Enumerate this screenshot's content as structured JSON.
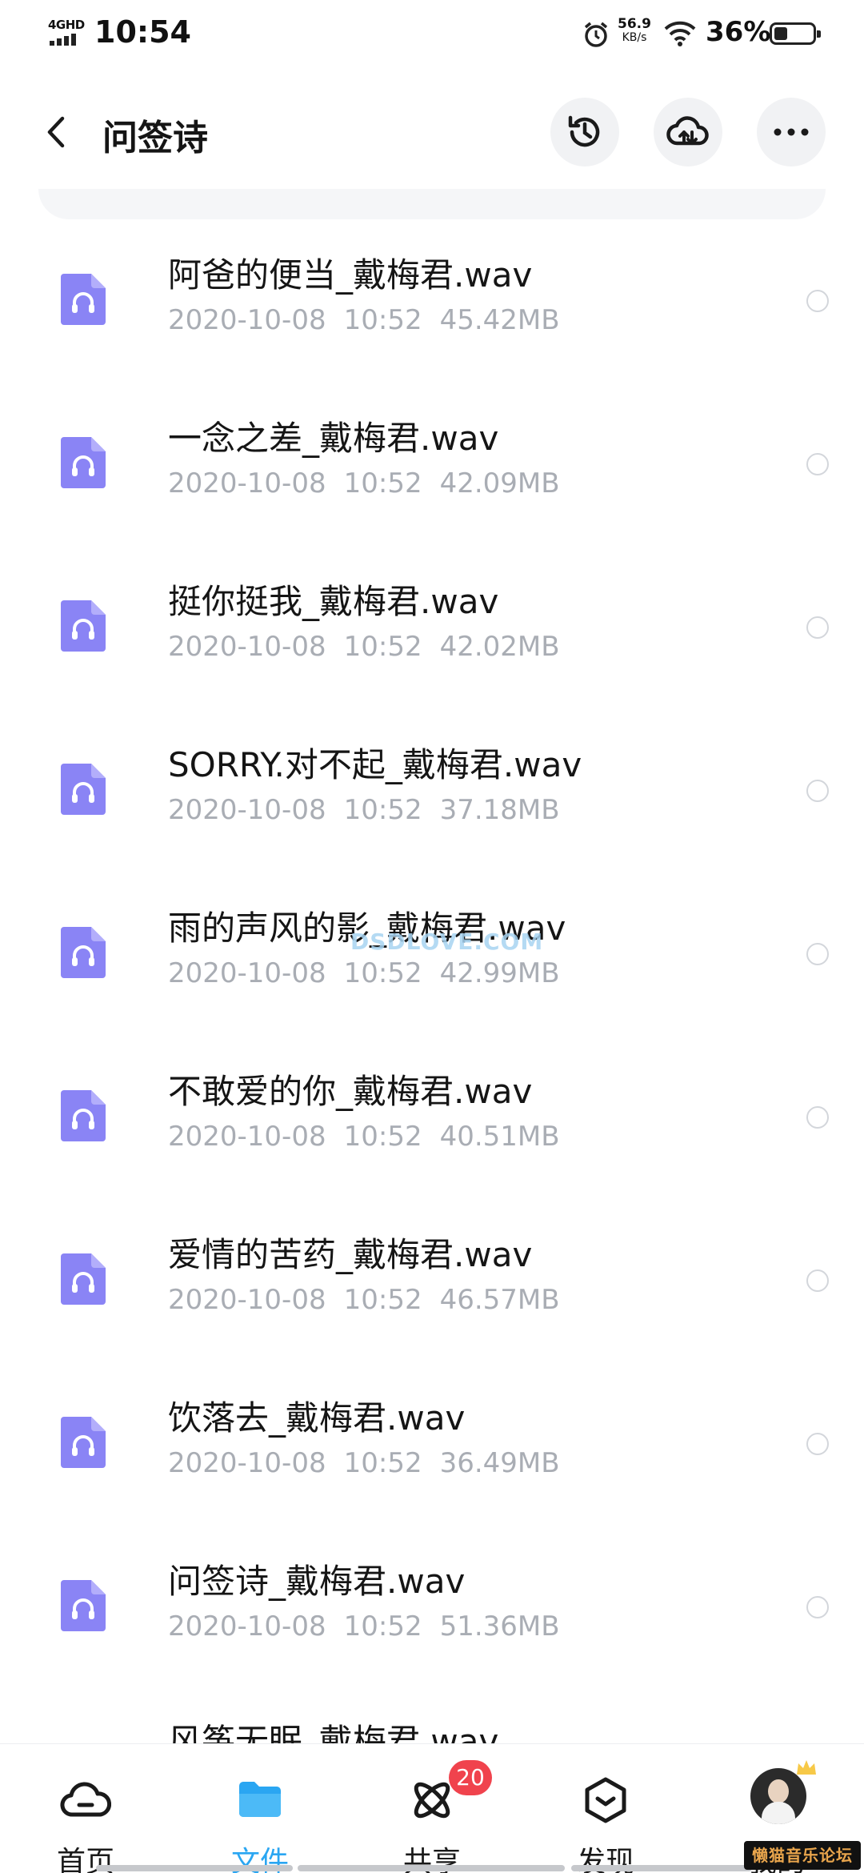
{
  "status_bar": {
    "network": "4GHD",
    "time": "10:54",
    "speed_value": "56.9",
    "speed_unit": "KB/s",
    "battery_percent": "36%",
    "battery_level": 0.36
  },
  "header": {
    "title": "问签诗",
    "icons": [
      "back-icon",
      "history-icon",
      "cloud-upload-icon",
      "more-icon"
    ]
  },
  "files": [
    {
      "name": "阿爸的便当_戴梅君.wav",
      "date": "2020-10-08",
      "time": "10:52",
      "size": "45.42MB"
    },
    {
      "name": "一念之差_戴梅君.wav",
      "date": "2020-10-08",
      "time": "10:52",
      "size": "42.09MB"
    },
    {
      "name": "挺你挺我_戴梅君.wav",
      "date": "2020-10-08",
      "time": "10:52",
      "size": "42.02MB"
    },
    {
      "name": "SORRY.对不起_戴梅君.wav",
      "date": "2020-10-08",
      "time": "10:52",
      "size": "37.18MB"
    },
    {
      "name": "雨的声风的影_戴梅君.wav",
      "date": "2020-10-08",
      "time": "10:52",
      "size": "42.99MB"
    },
    {
      "name": "不敢爱的你_戴梅君.wav",
      "date": "2020-10-08",
      "time": "10:52",
      "size": "40.51MB"
    },
    {
      "name": "爱情的苦药_戴梅君.wav",
      "date": "2020-10-08",
      "time": "10:52",
      "size": "46.57MB"
    },
    {
      "name": "饮落去_戴梅君.wav",
      "date": "2020-10-08",
      "time": "10:52",
      "size": "36.49MB"
    },
    {
      "name": "问签诗_戴梅君.wav",
      "date": "2020-10-08",
      "time": "10:52",
      "size": "51.36MB"
    },
    {
      "name": "风筝无眠_戴梅君.wav"
    }
  ],
  "watermark": "DSDLOVE.COM",
  "bottom_nav": {
    "home": "首页",
    "files": "文件",
    "share": "共享",
    "share_badge": "20",
    "discover": "发现",
    "mine": "我的"
  },
  "sticker": "懒猫音乐论坛",
  "colors": {
    "accent": "#2aa6f2",
    "file_icon": "#8a84f5",
    "badge": "#f0434d",
    "meta_text": "#a9adb4"
  }
}
